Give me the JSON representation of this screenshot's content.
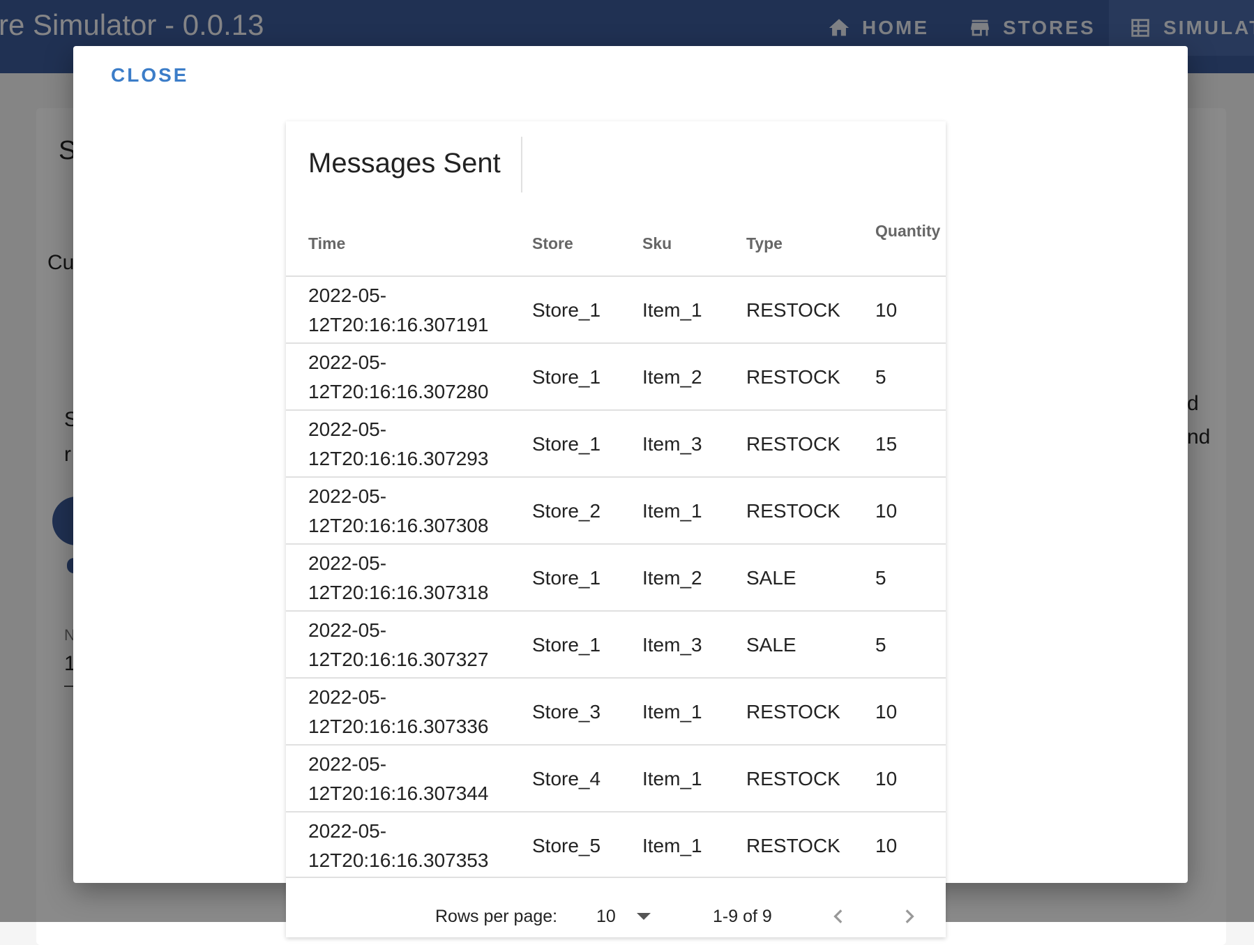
{
  "app": {
    "title": "re Simulator - 0.0.13",
    "nav": {
      "home": "HOME",
      "stores": "STORES",
      "simulator": "SIMULAT"
    }
  },
  "background": {
    "fragments": [
      "S",
      "Cu",
      "S",
      "r",
      "N",
      "1",
      "d",
      "nd"
    ]
  },
  "dialog": {
    "close_label": "CLOSE",
    "table": {
      "title": "Messages Sent",
      "columns": {
        "time": "Time",
        "store": "Store",
        "sku": "Sku",
        "type": "Type",
        "quantity": "Quantity"
      },
      "rows": [
        {
          "time_a": "2022-05-",
          "time_b": "12T20:16:16.307191",
          "store": "Store_1",
          "sku": "Item_1",
          "type": "RESTOCK",
          "quantity": "10"
        },
        {
          "time_a": "2022-05-",
          "time_b": "12T20:16:16.307280",
          "store": "Store_1",
          "sku": "Item_2",
          "type": "RESTOCK",
          "quantity": "5"
        },
        {
          "time_a": "2022-05-",
          "time_b": "12T20:16:16.307293",
          "store": "Store_1",
          "sku": "Item_3",
          "type": "RESTOCK",
          "quantity": "15"
        },
        {
          "time_a": "2022-05-",
          "time_b": "12T20:16:16.307308",
          "store": "Store_2",
          "sku": "Item_1",
          "type": "RESTOCK",
          "quantity": "10"
        },
        {
          "time_a": "2022-05-",
          "time_b": "12T20:16:16.307318",
          "store": "Store_1",
          "sku": "Item_2",
          "type": "SALE",
          "quantity": "5"
        },
        {
          "time_a": "2022-05-",
          "time_b": "12T20:16:16.307327",
          "store": "Store_1",
          "sku": "Item_3",
          "type": "SALE",
          "quantity": "5"
        },
        {
          "time_a": "2022-05-",
          "time_b": "12T20:16:16.307336",
          "store": "Store_3",
          "sku": "Item_1",
          "type": "RESTOCK",
          "quantity": "10"
        },
        {
          "time_a": "2022-05-",
          "time_b": "12T20:16:16.307344",
          "store": "Store_4",
          "sku": "Item_1",
          "type": "RESTOCK",
          "quantity": "10"
        },
        {
          "time_a": "2022-05-",
          "time_b": "12T20:16:16.307353",
          "store": "Store_5",
          "sku": "Item_1",
          "type": "RESTOCK",
          "quantity": "10"
        }
      ],
      "pagination": {
        "rows_per_page_label": "Rows per page:",
        "rows_per_page_value": "10",
        "range_text": "1-9 of 9"
      }
    }
  }
}
